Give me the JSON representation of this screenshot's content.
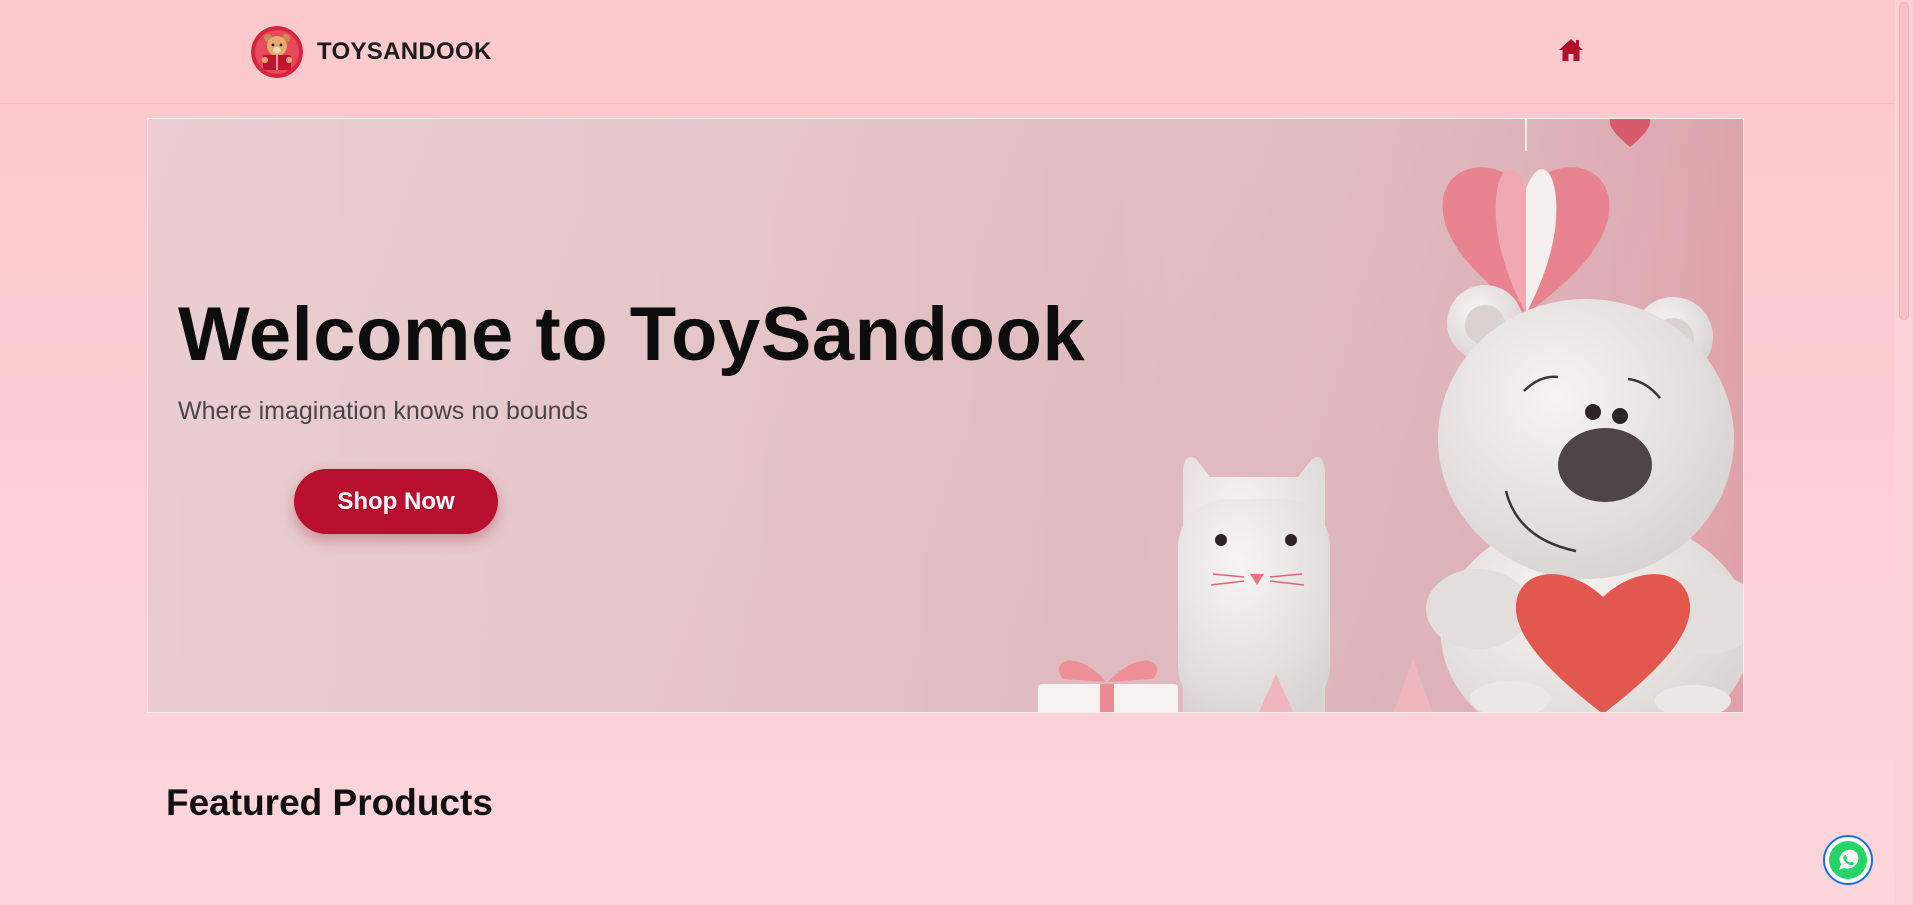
{
  "header": {
    "brand_name": "TOYSANDOOK",
    "logo_icon": "teddy-bear-reading-logo",
    "home_icon": "home-icon"
  },
  "hero": {
    "title": "Welcome to ToySandook",
    "subtitle": "Where imagination knows no bounds",
    "cta_label": "Shop Now"
  },
  "featured": {
    "title": "Featured Products"
  },
  "floating": {
    "whatsapp_icon": "whatsapp-icon"
  },
  "colors": {
    "page_background": "#fcc9cd",
    "accent": "#b90f2f",
    "home_icon": "#b0102c",
    "whatsapp": "#25d366"
  }
}
